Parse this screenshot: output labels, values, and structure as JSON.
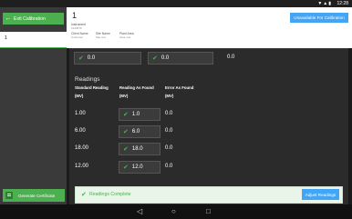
{
  "status_bar": {
    "time": "12:28",
    "icons": "▼▲▮"
  },
  "sidebar": {
    "exit_label": "Exit Calibration",
    "selected_item": "1",
    "generate_label": "Generate Certificate"
  },
  "header": {
    "title": "1",
    "instrument_label": "Instrument",
    "instrument_value": "1234576",
    "client_label": "Client Name",
    "client_value": "Customer",
    "site_label": "Site Name",
    "site_value": "Site one",
    "plant_label": "Plant Area",
    "plant_value": "Area one",
    "unavailable_label": "Unavailable For Calibration"
  },
  "top_row": {
    "value_a": "0.0",
    "value_b": "0.0",
    "value_c": "0.0"
  },
  "readings": {
    "title": "Readings",
    "col1_header": "Standard Reading",
    "col1_unit": "(MV)",
    "col2_header": "Reading As Found",
    "col2_unit": "(MV)",
    "col3_header": "Error As Found",
    "col3_unit": "(MV)",
    "rows": [
      {
        "standard": "1.00",
        "found": "1.0",
        "error": "0.0"
      },
      {
        "standard": "6.00",
        "found": "6.0",
        "error": "0.0"
      },
      {
        "standard": "18.00",
        "found": "18.0",
        "error": "0.0"
      },
      {
        "standard": "12.00",
        "found": "12.0",
        "error": "0.0"
      }
    ]
  },
  "footer": {
    "status": "Readings Complete",
    "adjust_label": "Adjust Readings"
  },
  "navbar": {
    "back": "◁",
    "home": "○",
    "recent": "□"
  },
  "colors": {
    "accent": "#4caf50",
    "button_blue": "#42a5f5",
    "panel": "#2b2b2b"
  }
}
